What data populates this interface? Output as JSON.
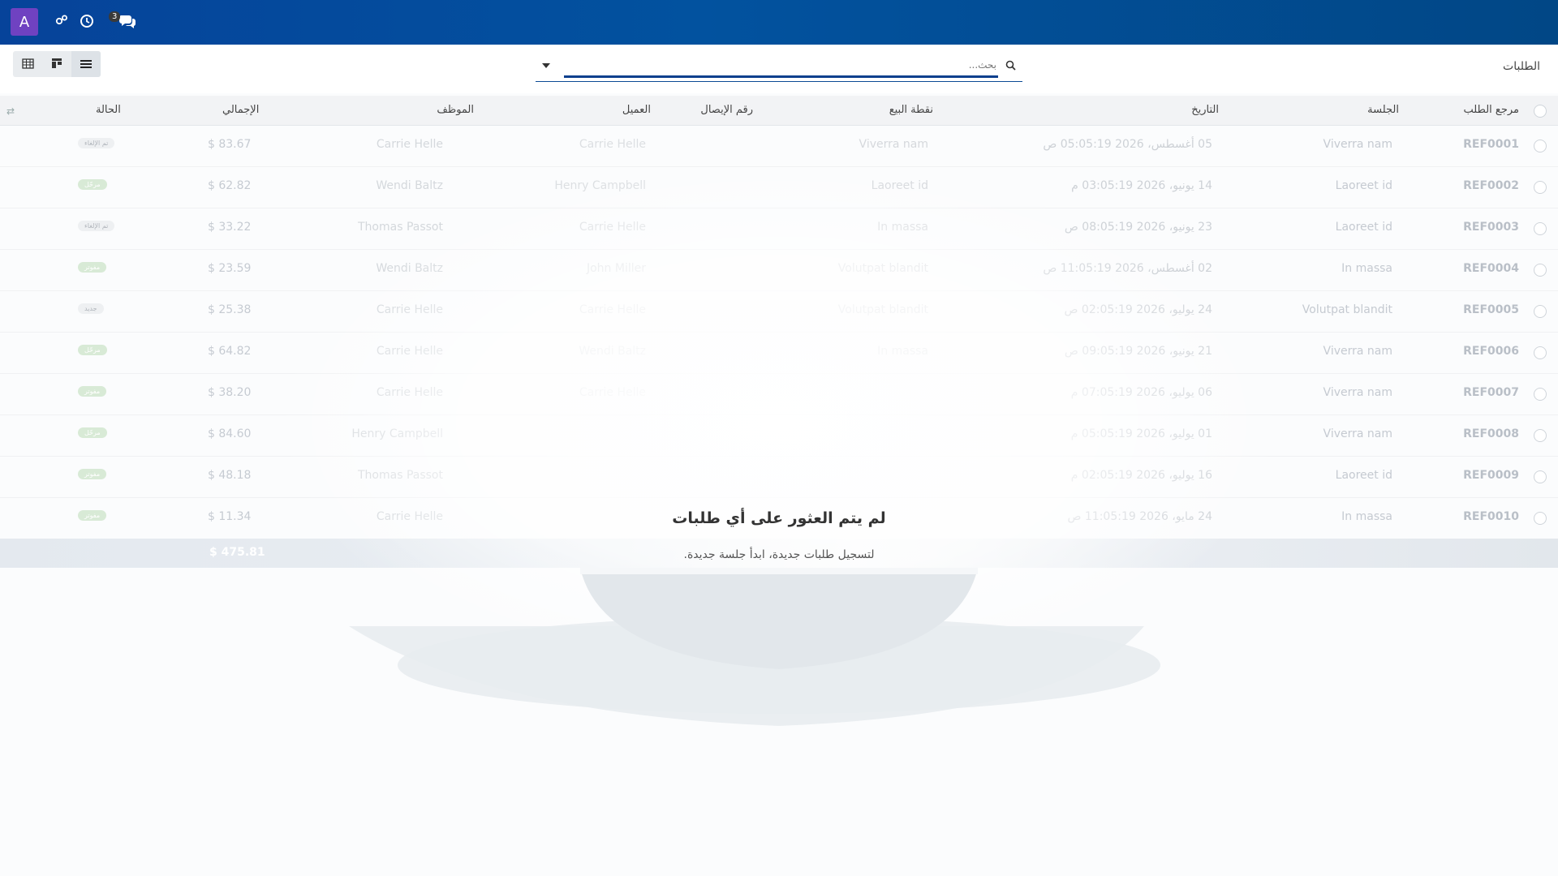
{
  "app": {
    "avatar_initial": "A",
    "messages_badge": "3",
    "breadcrumb": "الطلبات"
  },
  "search": {
    "placeholder": "بحث..."
  },
  "view_switcher": [
    {
      "name": "kanban-icon"
    },
    {
      "name": "table-icon"
    },
    {
      "name": "list-icon"
    }
  ],
  "table": {
    "headers": {
      "ref": "مرجع الطلب",
      "session": "الجلسة",
      "date": "التاريخ",
      "pos": "نقطة البيع",
      "receipt": "رقم الإيصال",
      "customer": "العميل",
      "employee": "الموظف",
      "total": "الإجمالي",
      "status": "الحالة"
    },
    "rows": [
      {
        "ref": "REF0001",
        "session": "Viverra nam",
        "date": "05 أغسطس، 2026 05:05:19 ص",
        "pos": "Viverra nam",
        "customer": "Carrie Helle",
        "employee": "Carrie Helle",
        "total": "$ 83.67",
        "status": "تم الإلغاء",
        "cancel": true
      },
      {
        "ref": "REF0002",
        "session": "Laoreet id",
        "date": "14 يونيو، 2026 03:05:19 م",
        "pos": "Laoreet id",
        "customer": "Henry Campbell",
        "employee": "Wendi Baltz",
        "total": "$ 62.82",
        "status": "مرحّل",
        "cancel": false
      },
      {
        "ref": "REF0003",
        "session": "Laoreet id",
        "date": "23 يونيو، 2026 08:05:19 ص",
        "pos": "In massa",
        "customer": "Carrie Helle",
        "employee": "Thomas Passot",
        "total": "$ 33.22",
        "status": "تم الإلغاء",
        "cancel": true
      },
      {
        "ref": "REF0004",
        "session": "In massa",
        "date": "02 أغسطس، 2026 11:05:19 ص",
        "pos": "Volutpat blandit",
        "customer": "John Miller",
        "employee": "Wendi Baltz",
        "total": "$ 23.59",
        "status": "مفوتر",
        "cancel": false
      },
      {
        "ref": "REF0005",
        "session": "Volutpat blandit",
        "date": "24 يوليو، 2026 02:05:19 ص",
        "pos": "Volutpat blandit",
        "customer": "Carrie Helle",
        "employee": "Carrie Helle",
        "total": "$ 25.38",
        "status": "جديد",
        "cancel": true
      },
      {
        "ref": "REF0006",
        "session": "Viverra nam",
        "date": "21 يونيو، 2026 09:05:19 ص",
        "pos": "In massa",
        "customer": "Wendi Baltz",
        "employee": "Carrie Helle",
        "total": "$ 64.82",
        "status": "مرحّل",
        "cancel": false
      },
      {
        "ref": "REF0007",
        "session": "Viverra nam",
        "date": "06 يوليو، 2026 07:05:19 م",
        "pos": "",
        "customer": "Carrie Helle",
        "employee": "Carrie Helle",
        "total": "$ 38.20",
        "status": "مفوتر",
        "cancel": false
      },
      {
        "ref": "REF0008",
        "session": "Viverra nam",
        "date": "01 يوليو، 2026 05:05:19 م",
        "pos": "",
        "customer": "",
        "employee": "Henry Campbell",
        "total": "$ 84.60",
        "status": "مرحّل",
        "cancel": false
      },
      {
        "ref": "REF0009",
        "session": "Laoreet id",
        "date": "16 يوليو، 2026 02:05:19 م",
        "pos": "",
        "customer": "",
        "employee": "Thomas Passot",
        "total": "$ 48.18",
        "status": "مفوتر",
        "cancel": false
      },
      {
        "ref": "REF0010",
        "session": "In massa",
        "date": "24 مايو، 2026 11:05:19 ص",
        "pos": "",
        "customer": "",
        "employee": "Carrie Helle",
        "total": "$ 11.34",
        "status": "مفوتر",
        "cancel": false
      }
    ],
    "grand_total": "$ 475.81"
  },
  "empty_state": {
    "title": "لم يتم العثور على أي طلبات",
    "subtitle": "لتسجيل طلبات جديدة، ابدأ جلسة جديدة."
  }
}
